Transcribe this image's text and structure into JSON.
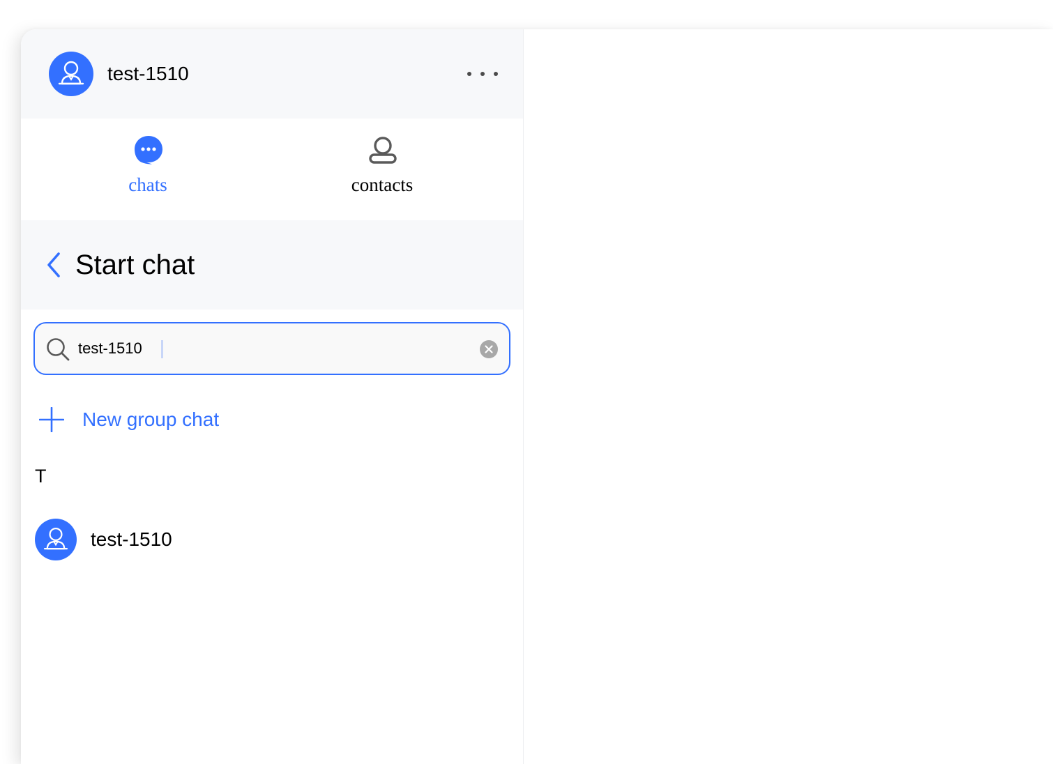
{
  "header": {
    "username": "test-1510",
    "avatar_icon": "person-avatar-icon",
    "more_icon": "more-dots-icon"
  },
  "tabs": [
    {
      "label": "chats",
      "icon": "chat-bubble-icon",
      "active": true
    },
    {
      "label": "contacts",
      "icon": "person-outline-icon",
      "active": false
    }
  ],
  "subheader": {
    "title": "Start chat",
    "back_icon": "chevron-left-icon"
  },
  "search": {
    "value": "test-1510",
    "placeholder": "",
    "search_icon": "search-icon",
    "clear_icon": "clear-circle-icon"
  },
  "new_group": {
    "label": "New group chat",
    "icon": "plus-icon"
  },
  "contacts": {
    "section_letter": "T",
    "items": [
      {
        "name": "test-1510",
        "avatar_icon": "person-avatar-icon"
      }
    ]
  },
  "colors": {
    "accent": "#3370ff",
    "header_bg": "#f7f8fa",
    "search_bg": "#f9f9f9",
    "text": "#000000",
    "icon_gray": "#5a5a5a"
  }
}
